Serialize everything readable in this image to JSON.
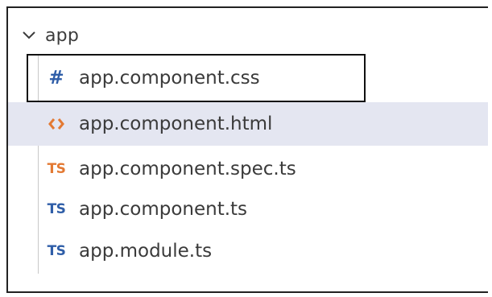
{
  "explorer": {
    "folder": {
      "name": "app",
      "icon": "chevron-down-icon",
      "expanded": true
    },
    "files": [
      {
        "name": "app.component.css",
        "icon": "css-hash-icon",
        "glyph": "#",
        "color": "#2f5ea8",
        "selected": true,
        "hovered": false
      },
      {
        "name": "app.component.html",
        "icon": "html-brackets-icon",
        "glyph": "<>",
        "color": "#e37933",
        "selected": false,
        "hovered": true
      },
      {
        "name": "app.component.spec.ts",
        "icon": "typescript-spec-icon",
        "glyph": "TS",
        "color": "#e37933",
        "selected": false,
        "hovered": false
      },
      {
        "name": "app.component.ts",
        "icon": "typescript-icon",
        "glyph": "TS",
        "color": "#2f5ea8",
        "selected": false,
        "hovered": false
      },
      {
        "name": "app.module.ts",
        "icon": "typescript-icon",
        "glyph": "TS",
        "color": "#2f5ea8",
        "selected": false,
        "hovered": false
      }
    ]
  },
  "colors": {
    "hover_background": "#e4e6f1",
    "indent_guide": "#c8c8c8",
    "text": "#3a3a3a",
    "css_blue": "#2f5ea8",
    "ts_orange": "#e37933"
  }
}
